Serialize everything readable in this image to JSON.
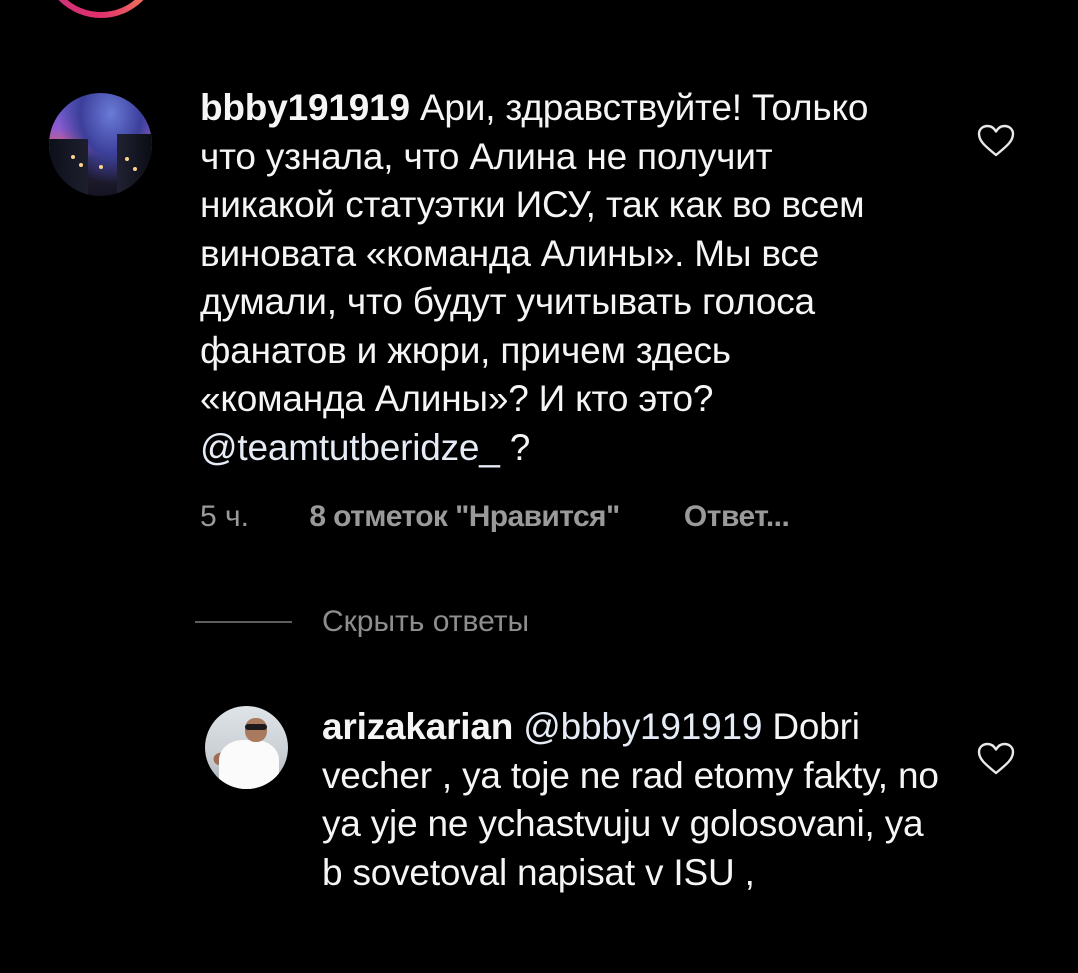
{
  "comments": [
    {
      "username": "bbby191919",
      "text": "Ари, здравствуйте! Только что узнала, что Алина не получит никакой статуэтки ИСУ, так как во всем виновата «команда Алины». Мы все думали, что будут учитывать голоса фанатов и жюри, причем здесь «команда Алины»? И кто это? ",
      "mention": "@teamtutberidze_",
      "text_end": " ?",
      "time": "5 ч.",
      "likes": "8 отметок \"Нравится\"",
      "reply": "Ответ..."
    },
    {
      "username": "arizakarian",
      "mention": "@bbby191919",
      "text": " Dobri vecher , ya toje ne rad etomy fakty, no ya yje ne ychastvuju v golosovani, ya b sovetoval napisat v ISU ,"
    }
  ],
  "hide_replies": "Скрыть ответы",
  "icons": {
    "like": "heart-outline-icon"
  },
  "colors": {
    "background": "#000000",
    "text": "#f5f5f5",
    "meta": "#9a9a9a"
  }
}
